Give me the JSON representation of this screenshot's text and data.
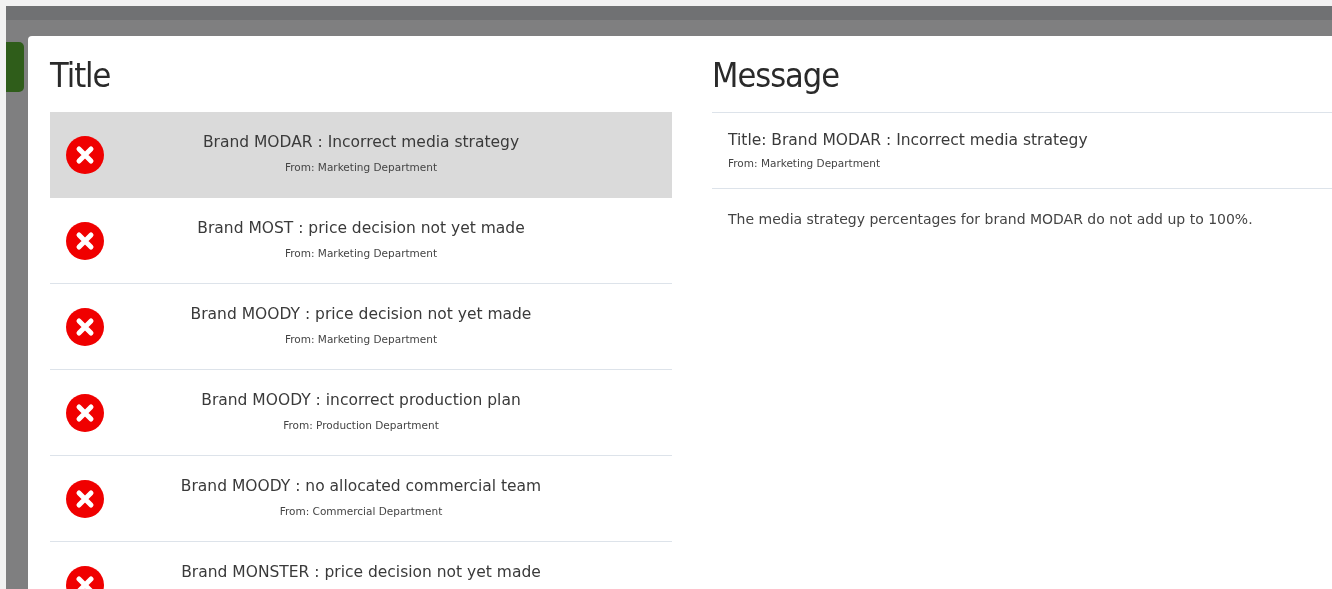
{
  "list": {
    "heading": "Title",
    "messages": [
      {
        "title": "Brand MODAR : Incorrect media strategy",
        "from": "From: Marketing Department",
        "selected": true
      },
      {
        "title": "Brand MOST : price decision not yet made",
        "from": "From: Marketing Department",
        "selected": false
      },
      {
        "title": "Brand MOODY : price decision not yet made",
        "from": "From: Marketing Department",
        "selected": false
      },
      {
        "title": "Brand MOODY : incorrect production plan",
        "from": "From: Production Department",
        "selected": false
      },
      {
        "title": "Brand MOODY : no allocated commercial team",
        "from": "From: Commercial Department",
        "selected": false
      },
      {
        "title": "Brand MONSTER : price decision not yet made",
        "selected": false
      }
    ]
  },
  "detail": {
    "heading": "Message",
    "title": "Title: Brand MODAR : Incorrect media strategy",
    "from": "From: Marketing Department",
    "body": "The media strategy percentages for brand MODAR do not add up to 100%."
  }
}
